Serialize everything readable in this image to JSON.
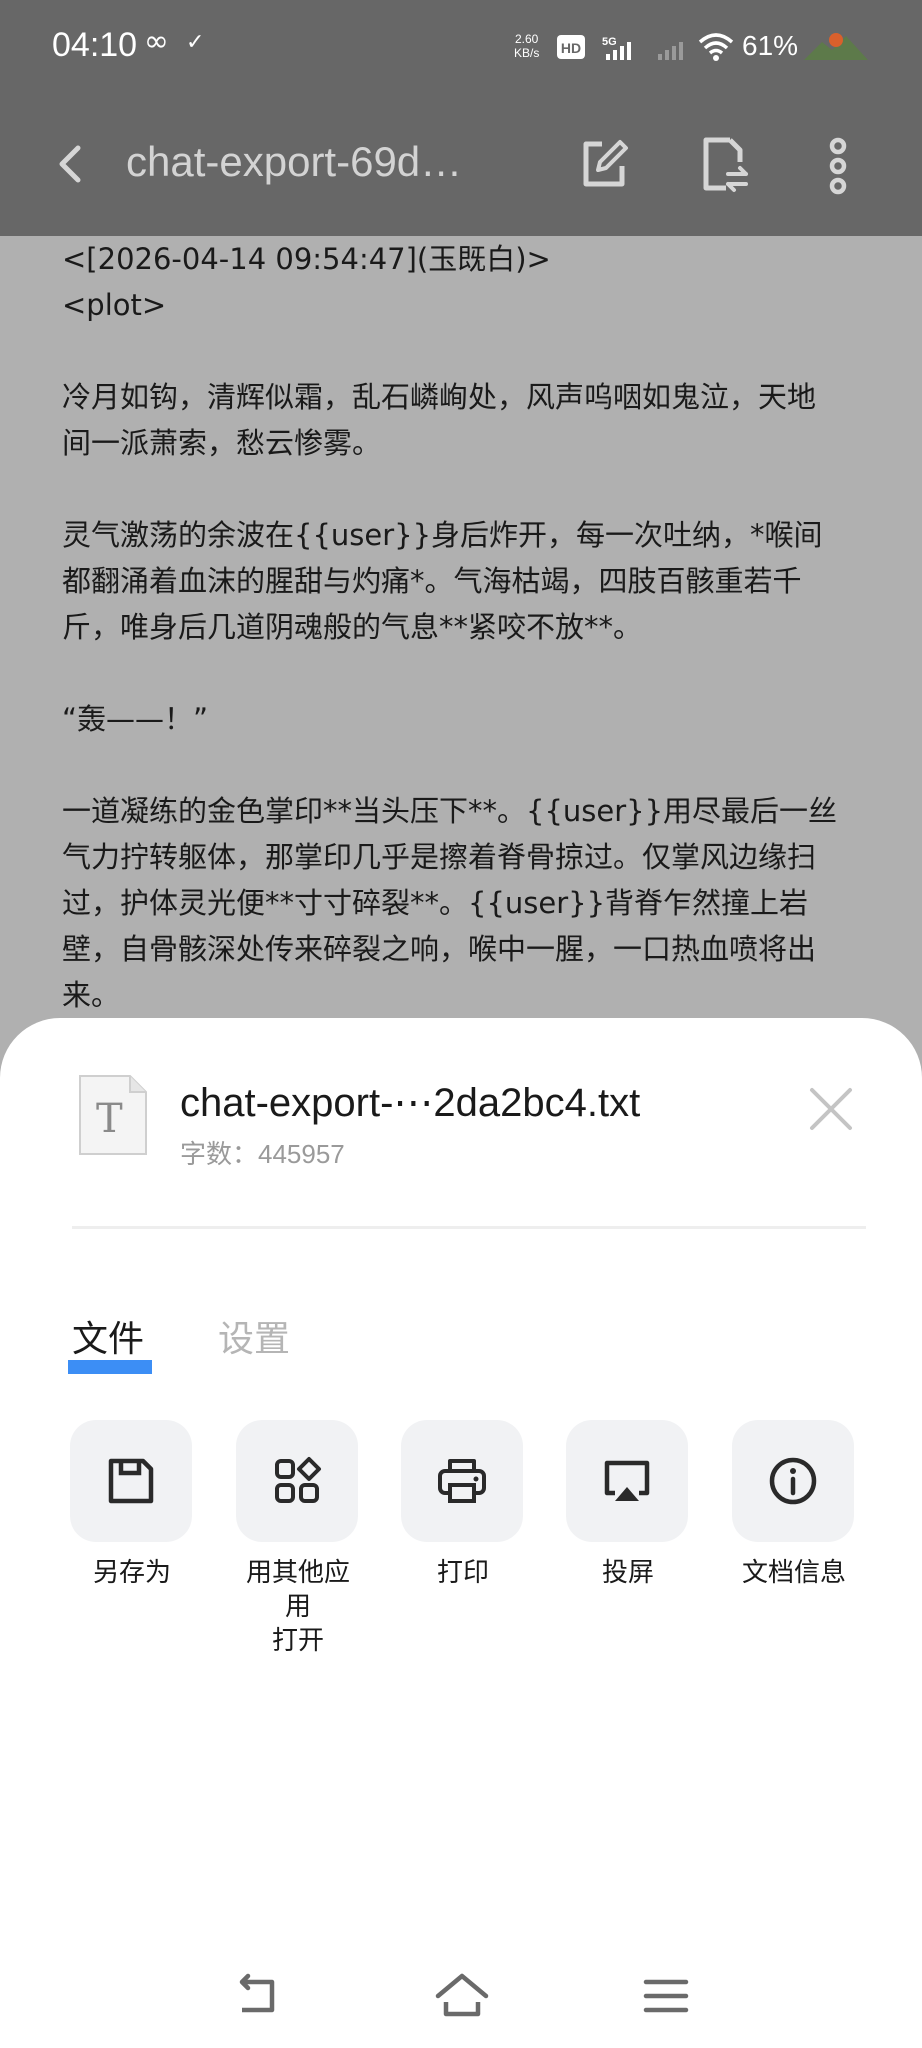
{
  "status_bar": {
    "time": "04:10",
    "speed_value": "2.60",
    "speed_unit": "KB/s",
    "battery": "61%"
  },
  "app_bar": {
    "title": "chat-export-69d…"
  },
  "document": {
    "lines": [
      "<[2026-04-14 09:54:47](玉既白)>",
      "<plot>",
      "",
      "冷月如钩，清辉似霜，乱石嶙峋处，风声呜咽如鬼泣，天地",
      "间一派萧索，愁云惨雾。",
      "",
      "灵气激荡的余波在{{user}}身后炸开，每一次吐纳，*喉间",
      "都翻涌着血沫的腥甜与灼痛*。气海枯竭，四肢百骸重若千",
      "斤，唯身后几道阴魂般的气息**紧咬不放**。",
      "",
      "“轰——！”",
      "",
      "一道凝练的金色掌印**当头压下**。{{user}}用尽最后一丝",
      "气力拧转躯体，那掌印几乎是擦着脊骨掠过。仅掌风边缘扫",
      "过，护体灵光便**寸寸碎裂**。{{user}}背脊乍然撞上岩",
      "壁，自骨骸深处传来碎裂之响，喉中一腥，一口热血喷将出",
      "来。"
    ]
  },
  "sheet": {
    "file_icon_letter": "T",
    "file_name": "chat-export-⋯2da2bc4.txt",
    "word_count": "字数：445957",
    "tabs": {
      "files": "文件",
      "settings": "设置"
    },
    "actions": [
      {
        "label": "另存为",
        "icon": "save-icon"
      },
      {
        "label_line1": "用其他应用",
        "label_line2": "打开",
        "icon": "open-with-icon"
      },
      {
        "label": "打印",
        "icon": "print-icon"
      },
      {
        "label": "投屏",
        "icon": "cast-icon"
      },
      {
        "label": "文档信息",
        "icon": "info-icon"
      }
    ]
  },
  "colors": {
    "accent": "#3c8ef5",
    "overlay": "#676767",
    "doc_bg": "#b0b0b0"
  }
}
